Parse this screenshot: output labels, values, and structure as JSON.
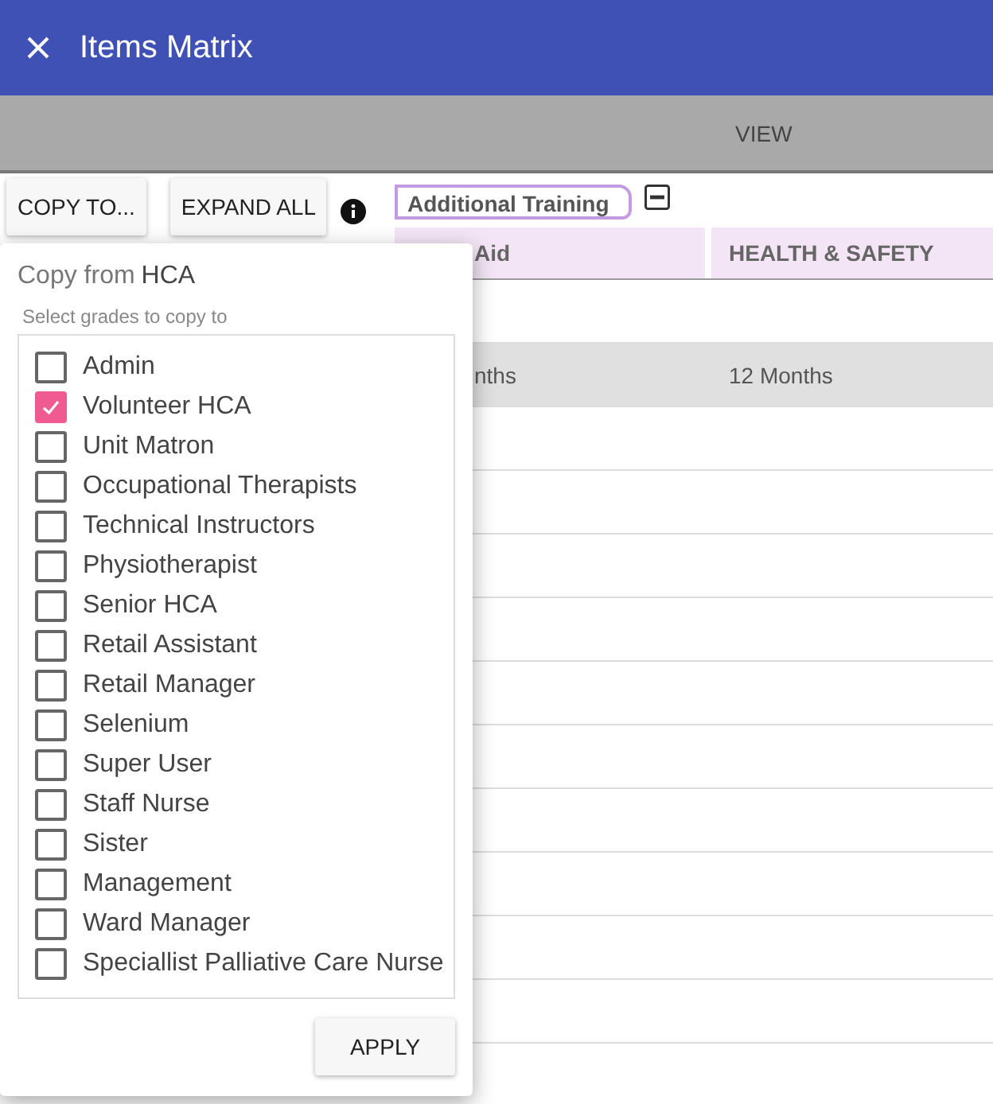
{
  "window": {
    "title": "Items Matrix"
  },
  "view_bar": {
    "label": "VIEW"
  },
  "toolbar": {
    "buttons": [
      "COPY TO...",
      "EXPAND ALL"
    ]
  },
  "group": {
    "label": "Additional Training",
    "expanded": true
  },
  "table": {
    "columns": [
      "Aid",
      "HEALTH & SAFETY"
    ],
    "rows": [
      {
        "highlighted": false
      },
      {
        "highlighted": true,
        "cells": [
          "nths",
          "12 Months"
        ]
      },
      {
        "highlighted": false
      },
      {
        "highlighted": false
      },
      {
        "highlighted": false
      },
      {
        "highlighted": false
      },
      {
        "highlighted": false
      },
      {
        "highlighted": false
      },
      {
        "highlighted": false
      },
      {
        "highlighted": false
      },
      {
        "highlighted": false
      },
      {
        "highlighted": false
      }
    ]
  },
  "copy_popup": {
    "title": "Copy from",
    "source_grade": "HCA",
    "hint": "Select grades to copy to",
    "grades": [
      {
        "label": "Admin",
        "checked": false
      },
      {
        "label": "Volunteer HCA",
        "checked": true
      },
      {
        "label": "Unit Matron",
        "checked": false
      },
      {
        "label": "Occupational Therapists",
        "checked": false
      },
      {
        "label": "Technical Instructors",
        "checked": false
      },
      {
        "label": "Physiotherapist",
        "checked": false
      },
      {
        "label": "Senior HCA",
        "checked": false
      },
      {
        "label": "Retail Assistant",
        "checked": false
      },
      {
        "label": "Retail Manager",
        "checked": false
      },
      {
        "label": "Selenium",
        "checked": false
      },
      {
        "label": "Super User",
        "checked": false
      },
      {
        "label": "Staff Nurse",
        "checked": false
      },
      {
        "label": "Sister",
        "checked": false
      },
      {
        "label": "Management",
        "checked": false
      },
      {
        "label": "Ward Manager",
        "checked": false
      },
      {
        "label": "Speciallist Palliative Care Nurse",
        "checked": false
      }
    ],
    "apply_button": "APPLY"
  }
}
